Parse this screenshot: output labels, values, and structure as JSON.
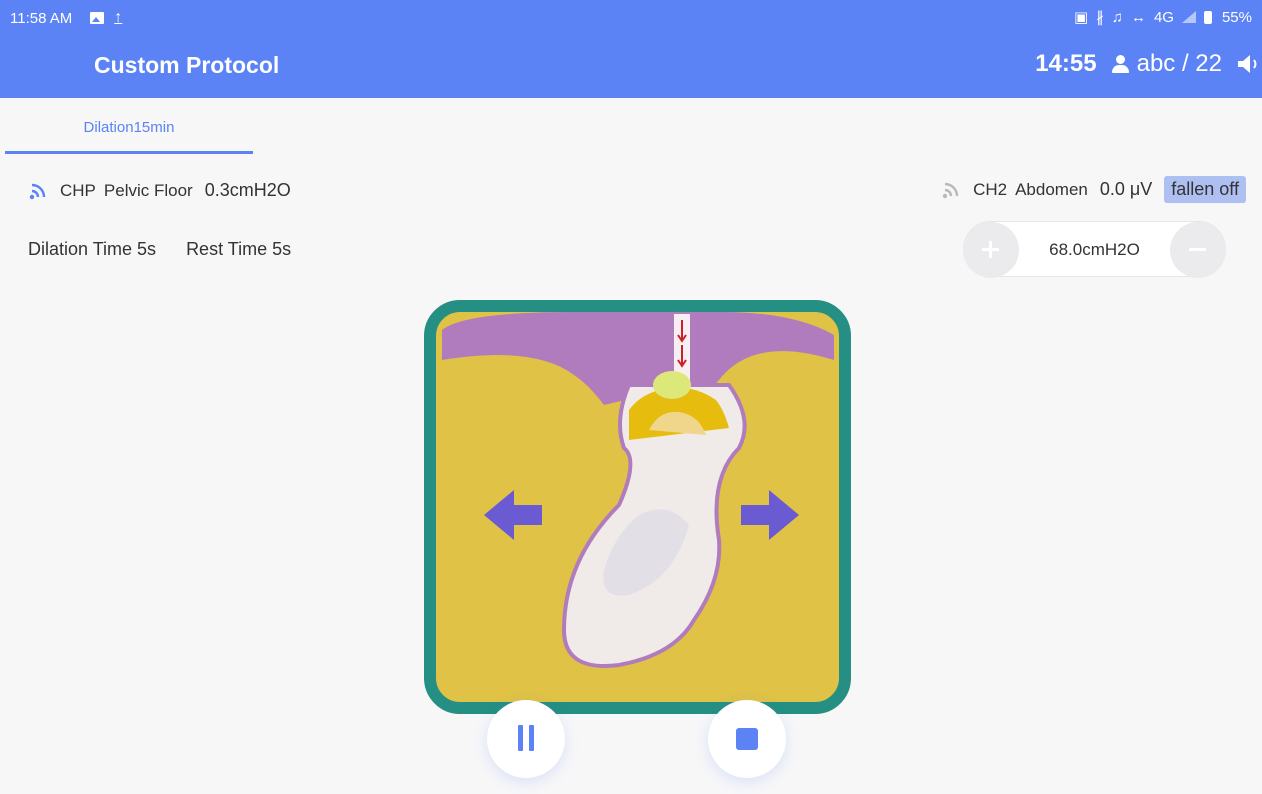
{
  "colors": {
    "accent": "#5b83f5",
    "panel_border": "#248f82",
    "panel_fill": "#dfc246",
    "arrow": "#6a5bd2",
    "badge_bg": "#aebff1",
    "tissue": "#b07cbd"
  },
  "status_bar": {
    "time": "11:58 AM",
    "network": "4G",
    "battery": "55%",
    "icons": [
      "gallery-icon",
      "upload-icon",
      "nfc-icon",
      "bluetooth-icon",
      "silent-icon",
      "data-arrows-icon",
      "signal-icon",
      "battery-icon"
    ]
  },
  "header": {
    "title": "Custom Protocol",
    "timer": "14:55",
    "user": "abc / 22",
    "icons": [
      "person-icon",
      "speaker-icon"
    ]
  },
  "tabs": [
    {
      "label": "Dilation15min",
      "active": true
    }
  ],
  "channels": [
    {
      "name": "CHP",
      "site": "Pelvic Floor",
      "value": "0.3cmH2O",
      "connected": true
    },
    {
      "name": "CH2",
      "site": "Abdomen",
      "value": "0.0 μV",
      "status": "fallen off",
      "connected": false
    }
  ],
  "protocol": {
    "dilation_time": "Dilation Time 5s",
    "rest_time": "Rest Time 5s"
  },
  "stepper": {
    "value": "68.0cmH2O",
    "icons": [
      "plus-icon",
      "minus-icon"
    ]
  },
  "animation": {
    "icons": [
      "arrow-left-icon",
      "arrow-right-icon",
      "balloon-probe-icon"
    ]
  },
  "controls": {
    "icons": [
      "pause-icon",
      "stop-icon"
    ]
  }
}
